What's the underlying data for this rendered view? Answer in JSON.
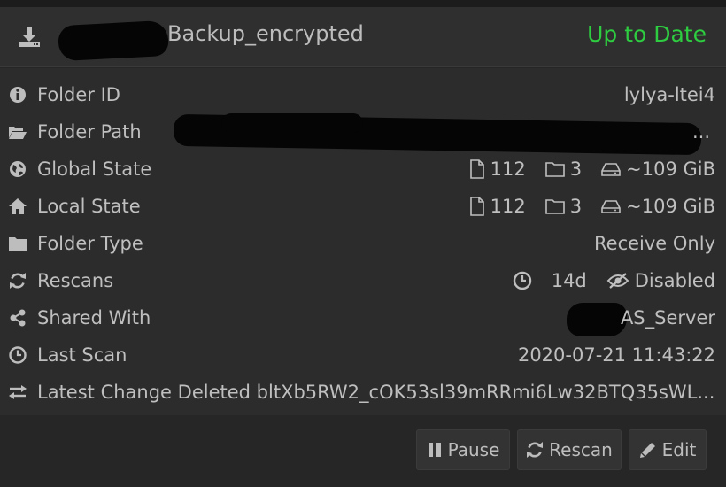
{
  "folder": {
    "title": "Backup_encrypted",
    "status": "Up to Date",
    "status_color": "#2ecc40"
  },
  "rows": {
    "folder_id": {
      "label": "Folder ID",
      "value": "lylya-ltei4"
    },
    "folder_path": {
      "label": "Folder Path",
      "value_suffix": "..."
    },
    "global_state": {
      "label": "Global State",
      "files": "112",
      "dirs": "3",
      "size": "~109 GiB"
    },
    "local_state": {
      "label": "Local State",
      "files": "112",
      "dirs": "3",
      "size": "~109 GiB"
    },
    "folder_type": {
      "label": "Folder Type",
      "value": "Receive Only"
    },
    "rescans": {
      "label": "Rescans",
      "interval": "14d",
      "watcher": "Disabled"
    },
    "shared_with": {
      "label": "Shared With",
      "value": "AS_Server"
    },
    "last_scan": {
      "label": "Last Scan",
      "value": "2020-07-21 11:43:22"
    },
    "latest_change": {
      "label": "Latest Change",
      "value": "Deleted bltXb5RW2_cOK53sl39mRRmi6Lw32BTQ35sWL..."
    }
  },
  "buttons": {
    "pause": "Pause",
    "rescan": "Rescan",
    "edit": "Edit"
  },
  "icons": {
    "header": "download-icon",
    "folder_id": "info-icon",
    "folder_path": "folder-open-icon",
    "global_state": "globe-icon",
    "local_state": "home-icon",
    "folder_type": "folder-icon",
    "rescans": "refresh-icon",
    "shared_with": "share-icon",
    "last_scan": "clock-icon",
    "latest_change": "exchange-icon"
  }
}
